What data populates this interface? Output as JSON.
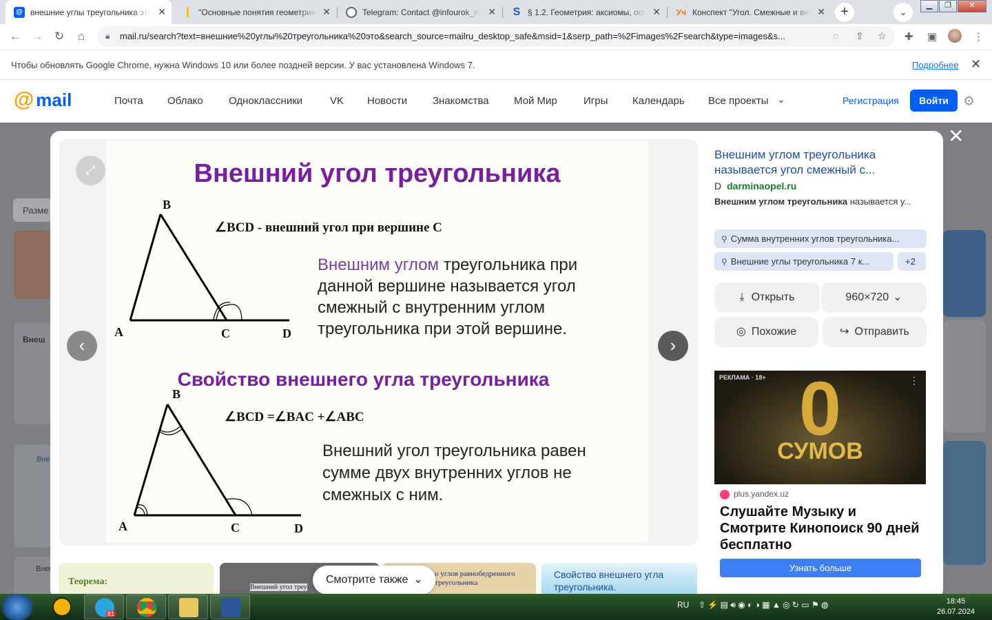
{
  "browser": {
    "tabs": [
      {
        "title": "внешние углы треугольника это",
        "active": true,
        "favicon": "mail-at-icon"
      },
      {
        "title": "\"Основные понятия геометрии",
        "active": false,
        "favicon": "yellow-bar-icon"
      },
      {
        "title": "Telegram: Contact @infourok_ru",
        "active": false,
        "favicon": "globe-icon"
      },
      {
        "title": "§ 1.2. Геометрия: аксиомы, осно",
        "active": false,
        "favicon": "s-icon"
      },
      {
        "title": "Конспект \"Угол. Смежные и вер",
        "active": false,
        "favicon": "infourok-icon"
      }
    ],
    "url": "mail.ru/search?text=внешние%20углы%20треугольника%20это&search_source=mailru_desktop_safe&msid=1&serp_path=%2Fimages%2Fsearch&type=images&s...",
    "infobar": {
      "message": "Чтобы обновлять Google Chrome, нужна Windows 10 или более поздней версии. У вас установлена Windows 7.",
      "link": "Подробнее"
    }
  },
  "mail_header": {
    "logo_at": "@",
    "logo_text": "mail",
    "nav": [
      "Почта",
      "Облако",
      "Одноклассники",
      "VK",
      "Новости",
      "Знакомства",
      "Мой Мир",
      "Игры",
      "Календарь",
      "Все проекты"
    ],
    "register": "Регистрация",
    "login": "Войти"
  },
  "background": {
    "size_filter": "Разме",
    "snippet1": "Внеш",
    "snippet2": "Внеш",
    "snippet3": "Внеш"
  },
  "slide": {
    "title": "Внешний угол треугольника",
    "formula1": "∠BCD - внешний угол при вершине C",
    "def_accent": "Внешним углом",
    "def_rest": " треугольника при данной вершине называется угол смежный с внутренним углом треугольника при этой вершине.",
    "subtitle": "Свойство внешнего угла треугольника",
    "formula2": "∠BCD =∠BAC +∠ABC",
    "property": "Внешний угол треугольника равен сумме двух внутренних углов не смежных с ним.",
    "labels1": {
      "a": "A",
      "b": "B",
      "c": "C",
      "d": "D"
    },
    "labels2": {
      "a": "A",
      "b": "B",
      "c": "C",
      "d": "D"
    }
  },
  "panel": {
    "title": "Внешним углом треугольника называется угол смежный с...",
    "source_icon": "D",
    "source": "darminaopel.ru",
    "desc_bold": "Внешним углом треугольника",
    "desc_rest": " называется у...",
    "chip1": "Сумма внутренних углов треугольника...",
    "chip2": "Внешние углы треугольника 7 к...",
    "chip_more": "+2",
    "open": "Открыть",
    "resolution": "960×720",
    "similar": "Похожие",
    "share": "Отправить"
  },
  "ad": {
    "label": "РЕКЛАМА · 18+",
    "big_digit": "0",
    "big_word": "СУМОВ",
    "source": "plus.yandex.uz",
    "title": "Слушайте Музыку и Смотрите Кинопоиск 90 дней бесплатно",
    "button": "Узнать больше"
  },
  "related": {
    "see_also": "Смотрите также",
    "thumb1": "Теорема:",
    "thumb2": "Внешний угол треу",
    "thumb3": "о углов равнобедренного треугольника",
    "thumb4": "Свойство внешнего угла треугольника."
  },
  "taskbar": {
    "telegram_badge": "81",
    "lang": "RU",
    "time": "18:45",
    "date": "26.07.2024"
  },
  "colors": {
    "slide_title": "#7a1ea0",
    "mail_blue": "#005ff9",
    "mail_orange": "#ff9e00",
    "link_blue": "#1d4fa0",
    "source_green": "#1b7a2e"
  }
}
